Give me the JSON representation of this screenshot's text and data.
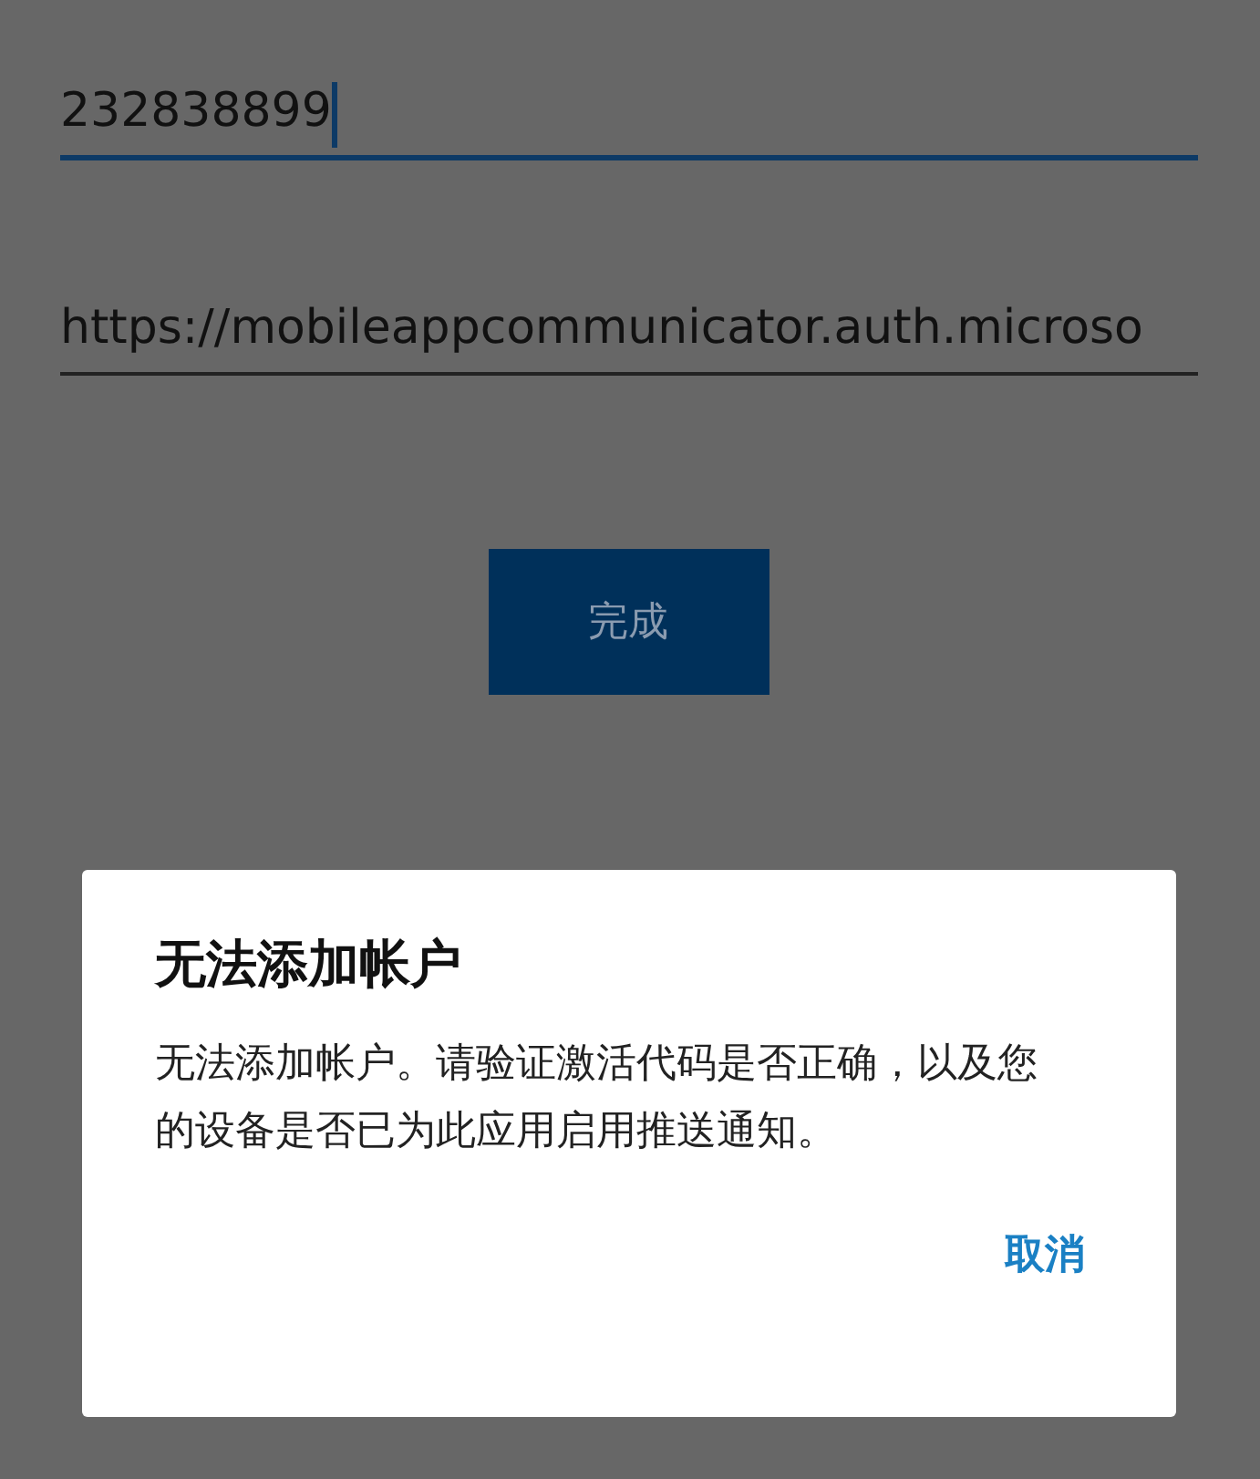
{
  "fields": [
    {
      "value": "232838899",
      "focused": true
    },
    {
      "value": "https://mobileappcommunicator.auth.microso",
      "focused": false
    }
  ],
  "done_button": {
    "label": "完成"
  },
  "dialog": {
    "title": "无法添加帐户",
    "message": "无法添加帐户。请验证激活代码是否正确，以及您的设备是否已为此应用启用推送通知。",
    "buttons": [
      "取消"
    ]
  }
}
